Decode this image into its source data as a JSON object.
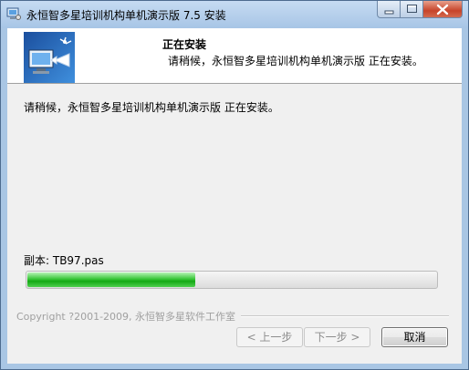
{
  "window": {
    "title": "永恒智多星培训机构单机演示版 7.5 安装"
  },
  "header": {
    "title": "正在安装",
    "subtitle": "请稍候，永恒智多星培训机构单机演示版 正在安装。"
  },
  "main": {
    "status": "请稍候，永恒智多星培训机构单机演示版 正在安装。",
    "file_label": "副本: TB97.pas",
    "progress_fraction": 0.41
  },
  "footer": {
    "copyright": "Copyright ?2001-2009, 永恒智多星软件工作室",
    "back_label": "< 上一步",
    "next_label": "下一步 >",
    "cancel_label": "取消"
  },
  "icons": {
    "app": "installer-computer-icon",
    "banner": "install-monitor-arrow-icon",
    "minimize": "minimize-icon",
    "maximize": "maximize-icon",
    "close": "close-icon"
  },
  "colors": {
    "progress_fill": "#22b522",
    "title_bar": "#b9d1ea",
    "close_button": "#c7442a"
  }
}
